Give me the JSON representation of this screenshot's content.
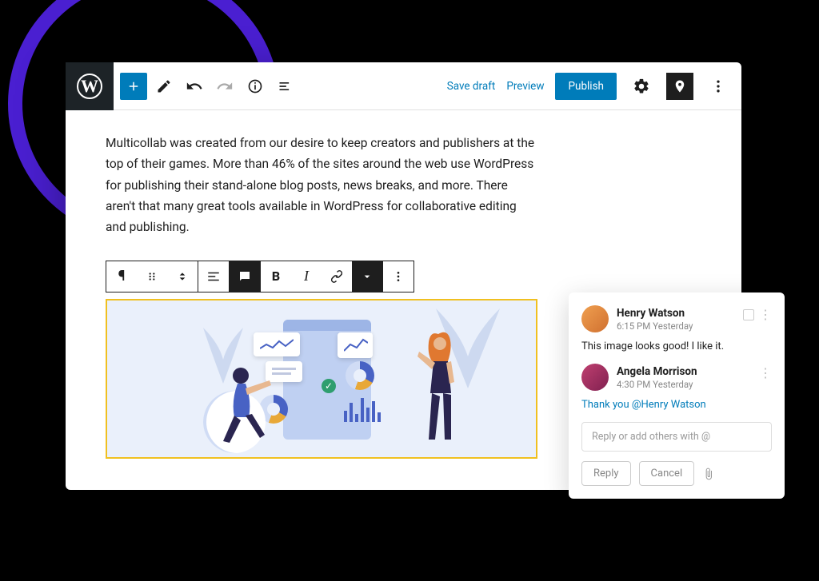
{
  "toolbar": {
    "save_draft": "Save draft",
    "preview": "Preview",
    "publish": "Publish"
  },
  "paragraph": "Multicollab was created from our desire to keep creators and publishers at the top of their games. More than 46% of the sites around the web use WordPress for publishing their stand-alone blog posts, news breaks, and more. There aren't that many great tools available in WordPress for collaborative editing and publishing.",
  "comments": [
    {
      "author": "Henry Watson",
      "time": "6:15 PM Yesterday",
      "body": "This image looks good! I like it."
    },
    {
      "author": "Angela Morrison",
      "time": "4:30 PM Yesterday",
      "body_prefix": "Thank you ",
      "mention": "@Henry Watson"
    }
  ],
  "reply": {
    "placeholder": "Reply or add others with @",
    "reply_label": "Reply",
    "cancel_label": "Cancel"
  }
}
